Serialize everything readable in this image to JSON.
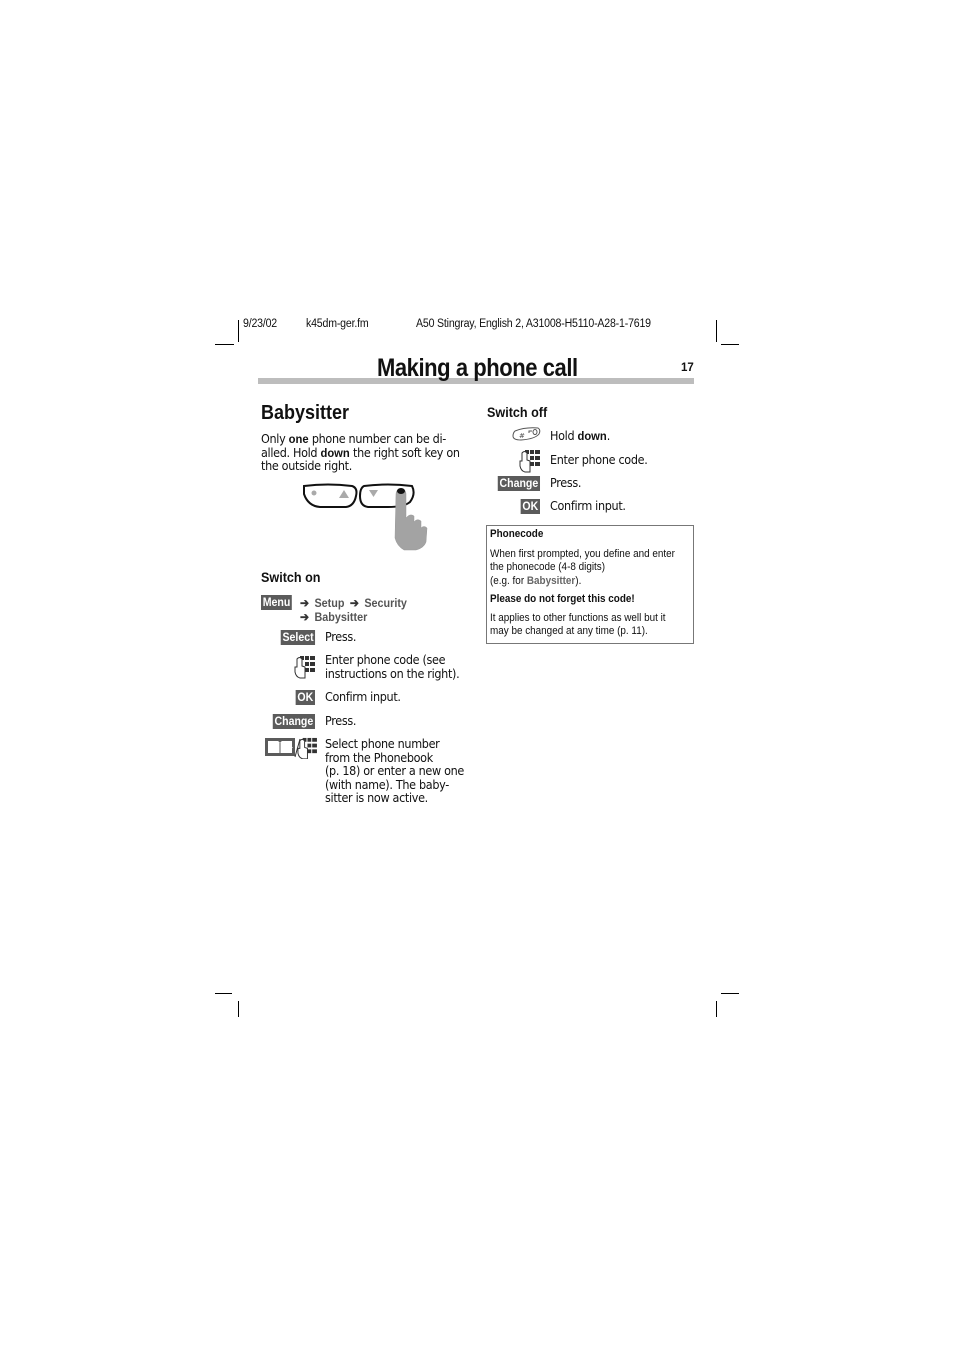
{
  "header": {
    "date": "9/23/02",
    "file": "k45dm-ger.fm",
    "doc_ref": "A50 Stingray, English 2, A31008-H5110-A28-1-7619"
  },
  "page": {
    "title": "Making a phone call",
    "number": "17"
  },
  "babysitter": {
    "heading": "Babysitter",
    "intro": {
      "line1_pre": "Only ",
      "line1_bold": "one",
      "line1_post": " phone number can be di-",
      "line2_pre": "alled. Hold ",
      "line2_bold": "down",
      "line2_post": " the right soft key on",
      "line3": "the outside right."
    },
    "illustration_icons": [
      "softkey-left-icon",
      "softkey-right-icon",
      "pressing-finger-icon"
    ]
  },
  "switch_on": {
    "heading": "Switch on",
    "menu_key": "Menu",
    "path": [
      "Setup",
      "Security",
      "Babysitter"
    ],
    "steps": [
      {
        "key": "Select",
        "text": "Press."
      },
      {
        "icon": "keypad-icon",
        "lines": [
          "Enter phone code (see",
          "instructions on the right)."
        ]
      },
      {
        "key": "OK",
        "text": "Confirm input."
      },
      {
        "key": "Change",
        "text": "Press."
      },
      {
        "icon": "phonebook-or-keypad-icon",
        "lines": [
          "Select phone number",
          "from the Phonebook",
          "(p. 18) or enter a new one",
          "(with name). The baby-",
          "sitter is now active."
        ]
      }
    ]
  },
  "switch_off": {
    "heading": "Switch off",
    "steps": [
      {
        "icon": "hash-key-icon",
        "text_pre": "Hold ",
        "text_bold": "down",
        "text_post": "."
      },
      {
        "icon": "keypad-icon",
        "text": "Enter phone code."
      },
      {
        "key": "Change",
        "text": "Press."
      },
      {
        "key": "OK",
        "text": "Confirm input."
      }
    ]
  },
  "note": {
    "title": "Phonecode",
    "para1": [
      "When first prompted, you define and enter",
      "the  phonecode (4-8 digits)"
    ],
    "para1_line3_pre": "(e.g. for ",
    "para1_line3_highlight": "Babysitter",
    "para1_line3_post": ").",
    "warning": "Please do not forget this code!",
    "para2": [
      "It applies to other functions as well but it",
      "may be changed at any time (p. 11)."
    ]
  }
}
